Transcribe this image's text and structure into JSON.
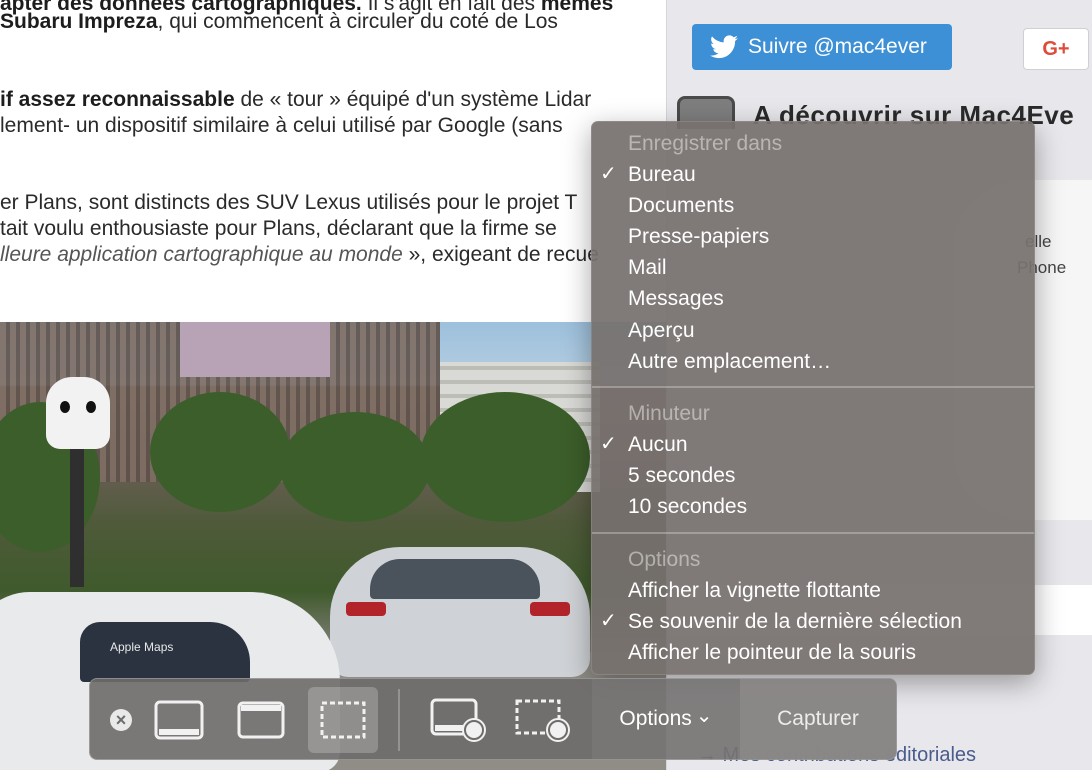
{
  "article": {
    "line1_bold": "apter des données cartographiques.",
    "line1_rest": " Il s'agit en fait des ",
    "line1_bold2": "mêmes",
    "line2_bold": "Subaru Impreza",
    "line2_rest": ", qui commencent à circuler du coté de Los",
    "line3_bold": "if assez reconnaissable",
    "line3_rest": " de « tour » équipé d'un système Lidar",
    "line4": "lement- un dispositif similaire à celui utilisé par Google (sans",
    "line5": "er Plans, sont distincts des SUV Lexus utilisés pour le projet T",
    "line6": "tait voulu enthousiaste pour Plans, déclarant que la firme se",
    "line7_italic": "lleure application cartographique au monde",
    "line7_rest": " », exigeant de recue",
    "car_label": "Apple Maps"
  },
  "sidebar": {
    "follow_label": "Suivre @mac4ever",
    "gplus_label": "G+",
    "discover_title": "A découvrir sur Mac4Eve",
    "sketch_text1": "elle",
    "sketch_text2": "Phone",
    "contrib_label": "→ Mes contributions éditoriales"
  },
  "menu": {
    "section_save_header": "Enregistrer dans",
    "save_items": [
      {
        "label": "Bureau",
        "checked": true
      },
      {
        "label": "Documents",
        "checked": false
      },
      {
        "label": "Presse-papiers",
        "checked": false
      },
      {
        "label": "Mail",
        "checked": false
      },
      {
        "label": "Messages",
        "checked": false
      },
      {
        "label": "Aperçu",
        "checked": false
      },
      {
        "label": "Autre emplacement…",
        "checked": false
      }
    ],
    "section_timer_header": "Minuteur",
    "timer_items": [
      {
        "label": "Aucun",
        "checked": true
      },
      {
        "label": "5 secondes",
        "checked": false
      },
      {
        "label": "10 secondes",
        "checked": false
      }
    ],
    "section_options_header": "Options",
    "option_items": [
      {
        "label": "Afficher la vignette flottante",
        "checked": false
      },
      {
        "label": "Se souvenir de la dernière sélection",
        "checked": true
      },
      {
        "label": "Afficher le pointeur de la souris",
        "checked": false
      }
    ],
    "check_glyph": "✓"
  },
  "toolbar": {
    "close_glyph": "×",
    "options_label": "Options",
    "options_chevron": "⌄",
    "capture_label": "Capturer",
    "active_tool": "capture-selection"
  }
}
